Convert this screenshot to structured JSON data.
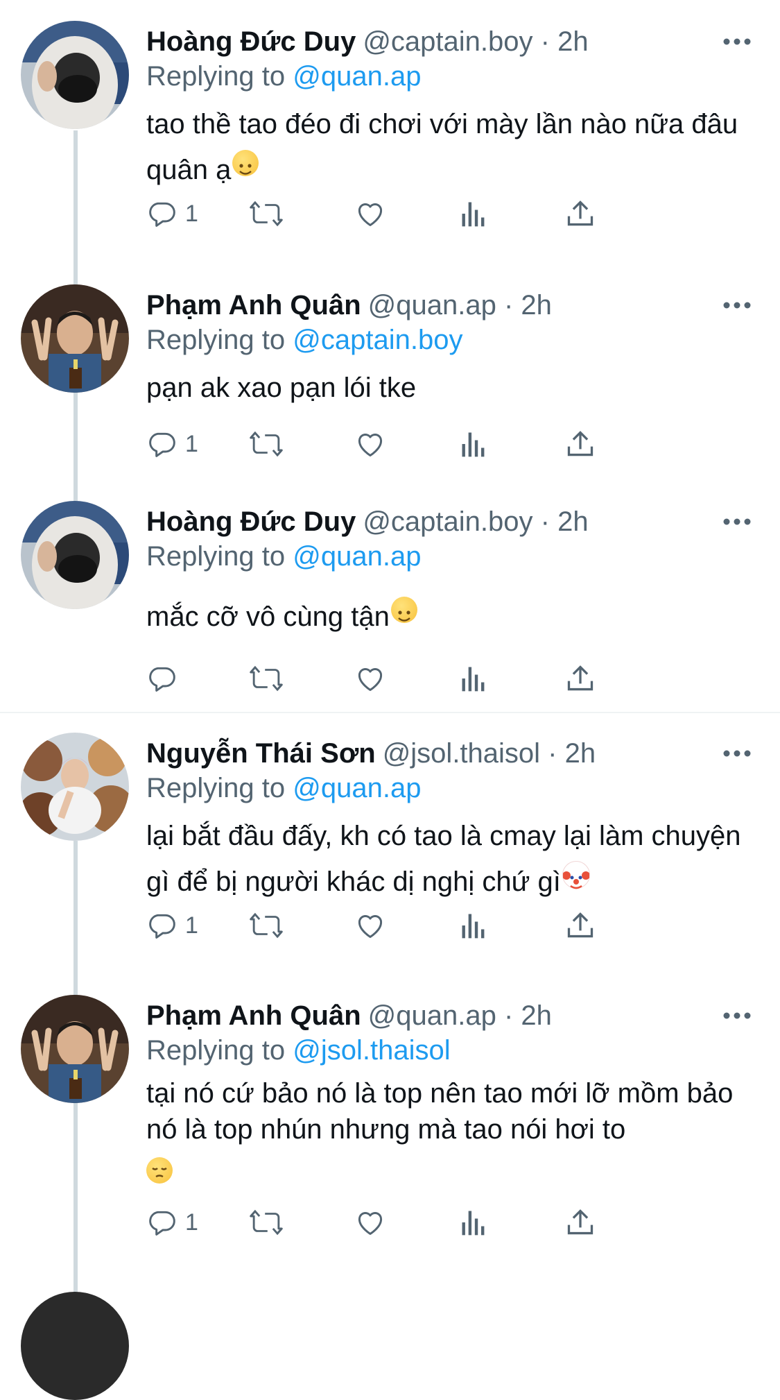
{
  "replying_prefix": "Replying to",
  "tweets": [
    {
      "name": "Hoàng Đức Duy",
      "handle": "@captain.boy · 2h",
      "reply_to": "@quan.ap",
      "text": "tao thề tao đéo đi chơi với mày lần nào nữa đâu quân ạ",
      "emoji": "slightly-smiling-face",
      "reply_count": "1"
    },
    {
      "name": "Phạm Anh Quân",
      "handle": "@quan.ap · 2h",
      "reply_to": "@captain.boy",
      "text": "pạn ak xao pạn lói tke",
      "reply_count": "1"
    },
    {
      "name": "Hoàng Đức Duy",
      "handle": "@captain.boy · 2h",
      "reply_to": "@quan.ap",
      "text": "mắc cỡ vô cùng tận",
      "emoji": "slightly-smiling-face",
      "reply_count": ""
    },
    {
      "name": "Nguyễn Thái Sơn",
      "handle": "@jsol.thaisol · 2h",
      "reply_to": "@quan.ap",
      "text": "lại bắt đầu đấy, kh có tao là cmay lại làm chuyện gì để bị người khác dị nghị chứ gì",
      "emoji": "clown-face",
      "reply_count": "1"
    },
    {
      "name": "Phạm Anh Quân",
      "handle": "@quan.ap · 2h",
      "reply_to": "@jsol.thaisol",
      "text": "tại nó cứ bảo nó là top nên tao mới lỡ mồm bảo nó là top nhún nhưng mà tao nói hơi to",
      "emoji": "pensive-face",
      "reply_count": "1"
    }
  ],
  "colors": {
    "link": "#1d9bf0",
    "secondary": "#536471",
    "thread_line": "#cfd9de"
  },
  "icons": [
    "reply-icon",
    "retweet-icon",
    "like-icon",
    "views-icon",
    "share-icon",
    "more-icon"
  ]
}
